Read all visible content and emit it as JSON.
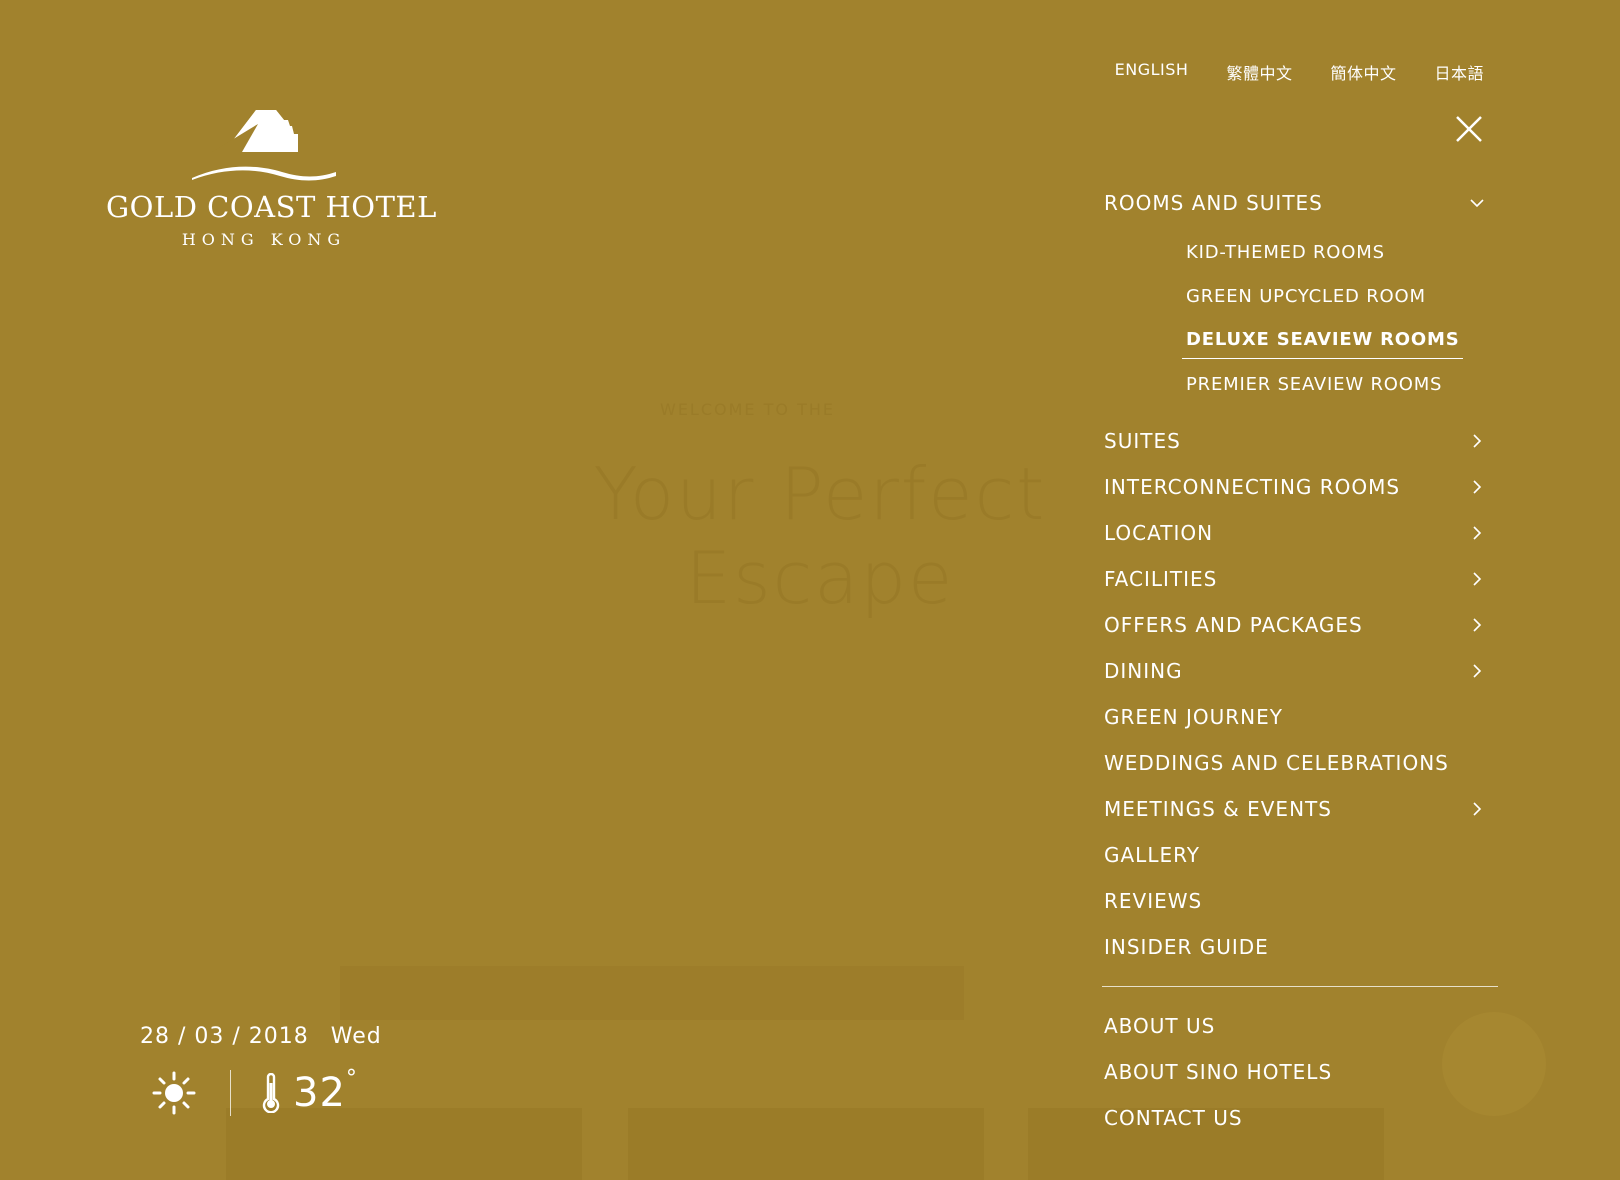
{
  "brand": {
    "name": "GOLD COAST HOTEL",
    "location": "HONG KONG"
  },
  "languages": [
    "ENGLISH",
    "繁體中文",
    "簡体中文",
    "日本語"
  ],
  "menu": {
    "rooms": {
      "label": "ROOMS AND SUITES",
      "children": [
        "KID-THEMED ROOMS",
        "GREEN UPCYCLED ROOM",
        "DELUXE SEAVIEW ROOMS",
        "PREMIER SEAVIEW ROOMS"
      ],
      "active_child": "DELUXE SEAVIEW ROOMS"
    },
    "items": [
      {
        "label": "SUITES",
        "has_children": true
      },
      {
        "label": "INTERCONNECTING ROOMS",
        "has_children": true
      },
      {
        "label": "LOCATION",
        "has_children": true
      },
      {
        "label": "FACILITIES",
        "has_children": true
      },
      {
        "label": "OFFERS AND PACKAGES",
        "has_children": true
      },
      {
        "label": "DINING",
        "has_children": true
      },
      {
        "label": "GREEN JOURNEY",
        "has_children": false
      },
      {
        "label": "WEDDINGS AND CELEBRATIONS",
        "has_children": false
      },
      {
        "label": "MEETINGS & EVENTS",
        "has_children": true
      },
      {
        "label": "GALLERY",
        "has_children": false
      },
      {
        "label": "REVIEWS",
        "has_children": false
      },
      {
        "label": "INSIDER GUIDE",
        "has_children": false
      }
    ],
    "secondary": [
      "ABOUT US",
      "ABOUT SINO HOTELS",
      "CONTACT US"
    ]
  },
  "info": {
    "date": "28 / 03 / 2018",
    "weekday": "Wed",
    "weather_icon": "sun-icon",
    "temperature": "32"
  },
  "background": {
    "welcome": "WELCOME TO THE",
    "headline": "Your Perfect Escape"
  },
  "colors": {
    "overlay": "#a1822d",
    "text": "#ffffff"
  }
}
